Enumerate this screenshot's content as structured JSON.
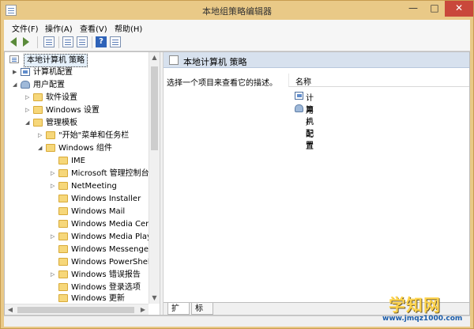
{
  "window": {
    "title": "本地组策略编辑器"
  },
  "menu": {
    "file": "文件(F)",
    "action": "操作(A)",
    "view": "查看(V)",
    "help": "帮助(H)"
  },
  "toolbar": {
    "help_glyph": "?"
  },
  "tree": {
    "items": [
      {
        "label": "本地计算机 策略",
        "icon": "policy-icon"
      },
      {
        "label": "计算机配置",
        "icon": "computer-icon"
      },
      {
        "label": "用户配置",
        "icon": "user-icon"
      },
      {
        "label": "软件设置",
        "icon": "folder-icon"
      },
      {
        "label": "Windows 设置",
        "icon": "folder-icon"
      },
      {
        "label": "管理模板",
        "icon": "folder-icon"
      },
      {
        "label": "\"开始\"菜单和任务栏",
        "icon": "folder-icon"
      },
      {
        "label": "Windows 组件",
        "icon": "folder-icon"
      },
      {
        "label": "IME",
        "icon": "folder-icon"
      },
      {
        "label": "Microsoft 管理控制台",
        "icon": "folder-icon"
      },
      {
        "label": "NetMeeting",
        "icon": "folder-icon"
      },
      {
        "label": "Windows Installer",
        "icon": "folder-icon"
      },
      {
        "label": "Windows Mail",
        "icon": "folder-icon"
      },
      {
        "label": "Windows Media Cente",
        "icon": "folder-icon"
      },
      {
        "label": "Windows Media Playe",
        "icon": "folder-icon"
      },
      {
        "label": "Windows Messenger",
        "icon": "folder-icon"
      },
      {
        "label": "Windows PowerShell",
        "icon": "folder-icon"
      },
      {
        "label": "Windows 错误报告",
        "icon": "folder-icon"
      },
      {
        "label": "Windows 登录选项",
        "icon": "folder-icon"
      },
      {
        "label": "Windows 更新",
        "icon": "folder-icon"
      }
    ]
  },
  "details": {
    "title": "本地计算机 策略",
    "description": "选择一个项目来查看它的描述。",
    "column_name": "名称",
    "items": [
      {
        "label": "计算机配置",
        "icon": "computer-icon"
      },
      {
        "label": "用户配置",
        "icon": "user-icon"
      }
    ]
  },
  "tabs": {
    "extended": "扩展",
    "standard": "标准"
  },
  "watermark": {
    "main": "学知网",
    "sub": "www.jmqz1000.com"
  },
  "colors": {
    "titlebar": "#e9c987",
    "close_button": "#c9483b",
    "header": "#d7e1ee"
  }
}
